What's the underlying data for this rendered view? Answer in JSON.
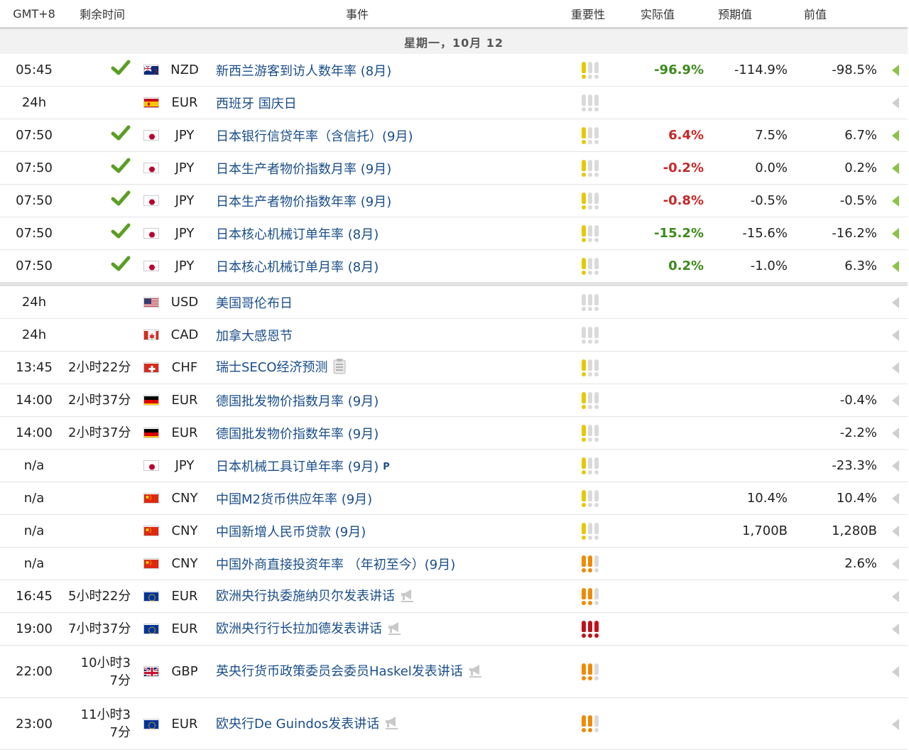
{
  "header": {
    "timezone": "GMT+8",
    "remaining": "剩余时间",
    "event": "事件",
    "importance": "重要性",
    "actual": "实际值",
    "forecast": "预期值",
    "previous": "前值"
  },
  "day_label": "星期一，10月 12",
  "colors": {
    "green": "#3c8a1b",
    "red": "#c62828",
    "link": "#1a4e8a",
    "imp_low": "#e8c800",
    "imp_med": "#f08a00",
    "imp_high": "#c0111a",
    "imp_off": "#dadada"
  },
  "rows": [
    {
      "time": "05:45",
      "remaining": "",
      "done": true,
      "flag": "nz-flag",
      "currency": "NZD",
      "event": "新西兰游客到访人数年率 (8月)",
      "icon": "",
      "importance": 1,
      "actual": "-96.9%",
      "actual_color": "green",
      "forecast": "-114.9%",
      "previous": "-98.5%",
      "arrow": "green"
    },
    {
      "time": "24h",
      "remaining": "",
      "done": false,
      "flag": "es-flag",
      "currency": "EUR",
      "event": "西班牙 国庆日",
      "icon": "",
      "importance": 0,
      "actual": "",
      "actual_color": "",
      "forecast": "",
      "previous": "",
      "arrow": "gray"
    },
    {
      "time": "07:50",
      "remaining": "",
      "done": true,
      "flag": "jp-flag",
      "currency": "JPY",
      "event": "日本银行信贷年率（含信托）(9月)",
      "icon": "",
      "importance": 1,
      "actual": "6.4%",
      "actual_color": "red",
      "forecast": "7.5%",
      "previous": "6.7%",
      "arrow": "green"
    },
    {
      "time": "07:50",
      "remaining": "",
      "done": true,
      "flag": "jp-flag",
      "currency": "JPY",
      "event": "日本生产者物价指数月率 (9月)",
      "icon": "",
      "importance": 1,
      "actual": "-0.2%",
      "actual_color": "red",
      "forecast": "0.0%",
      "previous": "0.2%",
      "arrow": "green"
    },
    {
      "time": "07:50",
      "remaining": "",
      "done": true,
      "flag": "jp-flag",
      "currency": "JPY",
      "event": "日本生产者物价指数年率 (9月)",
      "icon": "",
      "importance": 1,
      "actual": "-0.8%",
      "actual_color": "red",
      "forecast": "-0.5%",
      "previous": "-0.5%",
      "arrow": "green"
    },
    {
      "time": "07:50",
      "remaining": "",
      "done": true,
      "flag": "jp-flag",
      "currency": "JPY",
      "event": "日本核心机械订单年率 (8月)",
      "icon": "",
      "importance": 1,
      "actual": "-15.2%",
      "actual_color": "green",
      "forecast": "-15.6%",
      "previous": "-16.2%",
      "arrow": "green"
    },
    {
      "time": "07:50",
      "remaining": "",
      "done": true,
      "flag": "jp-flag",
      "currency": "JPY",
      "event": "日本核心机械订单月率 (8月)",
      "icon": "",
      "importance": 1,
      "actual": "0.2%",
      "actual_color": "green",
      "forecast": "-1.0%",
      "previous": "6.3%",
      "arrow": "green",
      "bar": true
    },
    {
      "time": "24h",
      "remaining": "",
      "done": false,
      "flag": "us-flag",
      "currency": "USD",
      "event": "美国哥伦布日",
      "icon": "",
      "importance": 0,
      "actual": "",
      "actual_color": "",
      "forecast": "",
      "previous": "",
      "arrow": "gray"
    },
    {
      "time": "24h",
      "remaining": "",
      "done": false,
      "flag": "ca-flag",
      "currency": "CAD",
      "event": "加拿大感恩节",
      "icon": "",
      "importance": 0,
      "actual": "",
      "actual_color": "",
      "forecast": "",
      "previous": "",
      "arrow": "gray"
    },
    {
      "time": "13:45",
      "remaining": "2小时22分",
      "done": false,
      "flag": "ch-flag",
      "currency": "CHF",
      "event": "瑞士SECO经济预测",
      "icon": "report",
      "importance": 1,
      "actual": "",
      "actual_color": "",
      "forecast": "",
      "previous": "",
      "arrow": "gray"
    },
    {
      "time": "14:00",
      "remaining": "2小时37分",
      "done": false,
      "flag": "de-flag",
      "currency": "EUR",
      "event": "德国批发物价指数月率 (9月)",
      "icon": "",
      "importance": 1,
      "actual": "",
      "actual_color": "",
      "forecast": "",
      "previous": "-0.4%",
      "arrow": "gray"
    },
    {
      "time": "14:00",
      "remaining": "2小时37分",
      "done": false,
      "flag": "de-flag",
      "currency": "EUR",
      "event": "德国批发物价指数年率 (9月)",
      "icon": "",
      "importance": 1,
      "actual": "",
      "actual_color": "",
      "forecast": "",
      "previous": "-2.2%",
      "arrow": "gray"
    },
    {
      "time": "n/a",
      "remaining": "",
      "done": false,
      "flag": "jp-flag",
      "currency": "JPY",
      "event": "日本机械工具订单年率 (9月)",
      "icon": "preliminary",
      "icon_text": "P",
      "importance": 1,
      "actual": "",
      "actual_color": "",
      "forecast": "",
      "previous": "-23.3%",
      "arrow": "gray"
    },
    {
      "time": "n/a",
      "remaining": "",
      "done": false,
      "flag": "cn-flag",
      "currency": "CNY",
      "event": "中国M2货币供应年率 (9月)",
      "icon": "",
      "importance": 1,
      "actual": "",
      "actual_color": "",
      "forecast": "10.4%",
      "previous": "10.4%",
      "arrow": "gray"
    },
    {
      "time": "n/a",
      "remaining": "",
      "done": false,
      "flag": "cn-flag",
      "currency": "CNY",
      "event": "中国新增人民币贷款 (9月)",
      "icon": "",
      "importance": 1,
      "actual": "",
      "actual_color": "",
      "forecast": "1,700B",
      "previous": "1,280B",
      "arrow": "gray"
    },
    {
      "time": "n/a",
      "remaining": "",
      "done": false,
      "flag": "cn-flag",
      "currency": "CNY",
      "event": "中国外商直接投资年率 （年初至今）(9月)",
      "icon": "",
      "importance": 2,
      "actual": "",
      "actual_color": "",
      "forecast": "",
      "previous": "2.6%",
      "arrow": "gray"
    },
    {
      "time": "16:45",
      "remaining": "5小时22分",
      "done": false,
      "flag": "eu-flag",
      "currency": "EUR",
      "event": "欧洲央行执委施纳贝尔发表讲话",
      "icon": "speech",
      "importance": 2,
      "actual": "",
      "actual_color": "",
      "forecast": "",
      "previous": "",
      "arrow": "gray"
    },
    {
      "time": "19:00",
      "remaining": "7小时37分",
      "done": false,
      "flag": "eu-flag",
      "currency": "EUR",
      "event": "欧洲央行行长拉加德发表讲话",
      "icon": "speech",
      "importance": 3,
      "actual": "",
      "actual_color": "",
      "forecast": "",
      "previous": "",
      "arrow": "gray"
    },
    {
      "time": "22:00",
      "remaining": "10小时37分",
      "done": false,
      "flag": "gb-flag",
      "currency": "GBP",
      "event": "英央行货币政策委员会委员Haskel发表讲话",
      "icon": "speech",
      "importance": 2,
      "actual": "",
      "actual_color": "",
      "forecast": "",
      "previous": "",
      "arrow": "gray",
      "tall": "h73"
    },
    {
      "time": "23:00",
      "remaining": "11小时37分",
      "done": false,
      "flag": "eu-flag",
      "currency": "EUR",
      "event": "欧央行De Guindos发表讲话",
      "icon": "speech",
      "importance": 2,
      "actual": "",
      "actual_color": "",
      "forecast": "",
      "previous": "",
      "arrow": "gray",
      "tall": "h72"
    }
  ]
}
